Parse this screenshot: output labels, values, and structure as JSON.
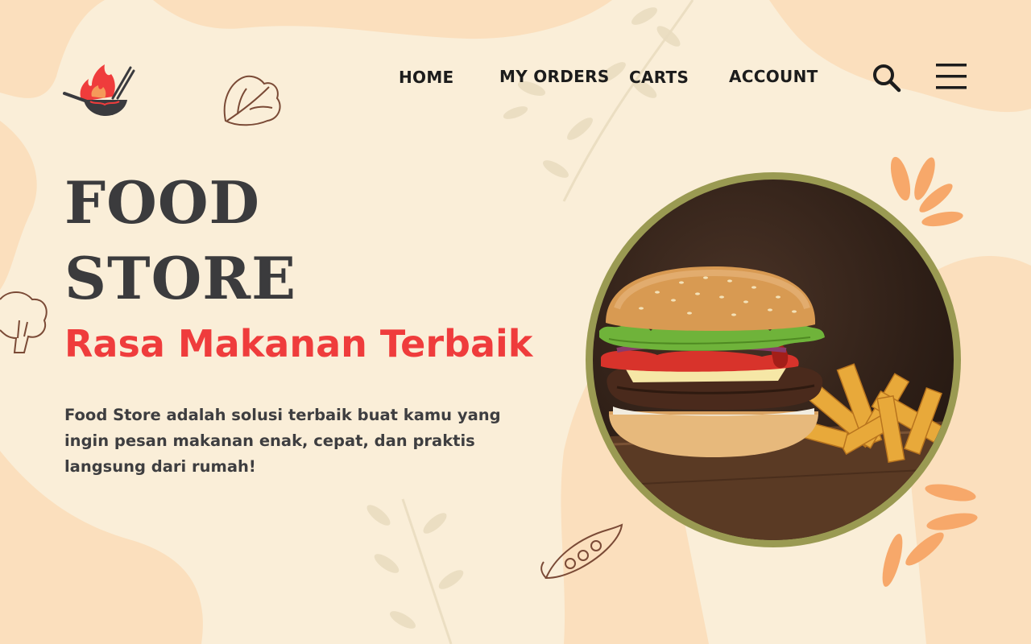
{
  "brand": {
    "logo_icon": "wok-flame-logo"
  },
  "nav": {
    "items": [
      {
        "label": "HOME"
      },
      {
        "label": "MY ORDERS"
      },
      {
        "label": "CARTS"
      },
      {
        "label": "ACCOUNT"
      }
    ],
    "search_icon": "search-icon",
    "menu_icon": "hamburger-menu-icon"
  },
  "hero": {
    "title_line1": "FOOD",
    "title_line2": "STORE",
    "subtitle": "Rasa Makanan Terbaik",
    "description": "Food Store adalah solusi terbaik buat kamu yang ingin pesan makanan enak, cepat, dan praktis langsung dari rumah!",
    "image_subject": "burger-and-fries-photo"
  },
  "colors": {
    "background": "#faeed8",
    "blob": "#fbdfbd",
    "title": "#3b3b3d",
    "accent_red": "#ef3c3c",
    "frame": "#9a9a52",
    "decor_orange": "#f7a86a"
  }
}
